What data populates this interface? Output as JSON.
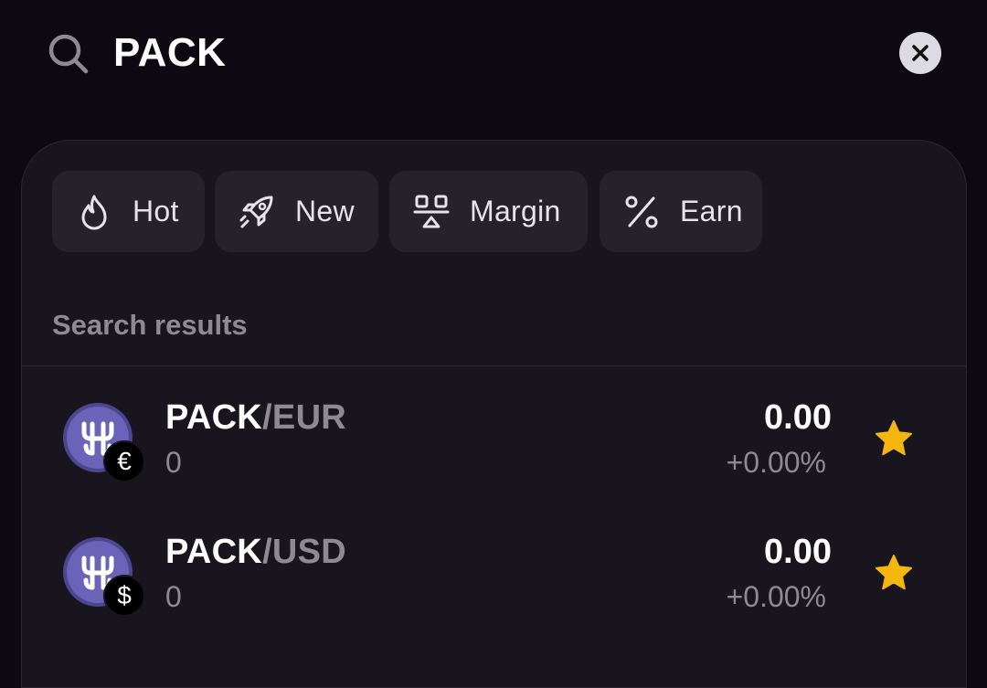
{
  "search": {
    "query": "PACK"
  },
  "filters": [
    {
      "label": "Hot",
      "icon": "flame-icon"
    },
    {
      "label": "New",
      "icon": "rocket-icon"
    },
    {
      "label": "Margin",
      "icon": "margin-icon"
    },
    {
      "label": "Earn",
      "icon": "percent-icon"
    }
  ],
  "results": {
    "title": "Search results",
    "items": [
      {
        "base": "PACK",
        "separator": "/",
        "quote": "EUR",
        "badge": "€",
        "volume": "0",
        "price": "0.00",
        "change": "+0.00%",
        "favorite": true
      },
      {
        "base": "PACK",
        "separator": "/",
        "quote": "USD",
        "badge": "$",
        "volume": "0",
        "price": "0.00",
        "change": "+0.00%",
        "favorite": true
      }
    ]
  },
  "colors": {
    "background": "#0c0912",
    "panel": "#18151f",
    "chip": "#25222c",
    "star": "#f5b70f",
    "coin": "#6a63b8",
    "muted_text": "#8d8a96"
  }
}
